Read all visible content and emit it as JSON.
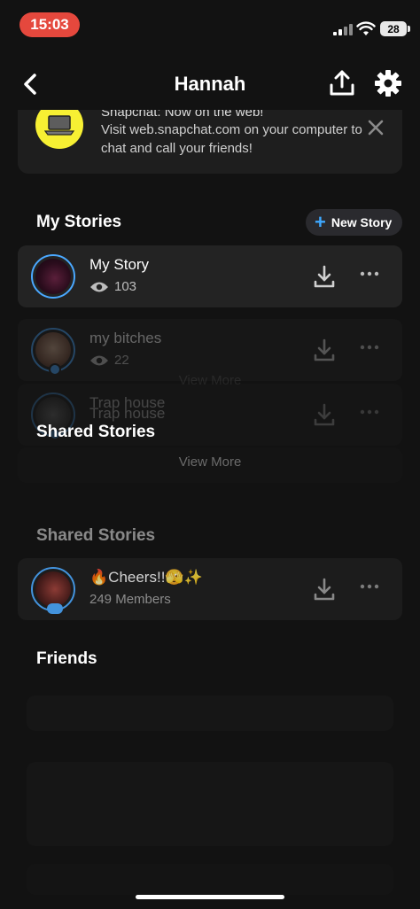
{
  "status": {
    "time": "15:03",
    "battery": "28"
  },
  "header": {
    "title": "Hannah"
  },
  "banner": {
    "title": "Snapchat: Now on the web!",
    "body": "Visit web.snapchat.com on your computer to chat and call your friends!"
  },
  "my_stories": {
    "title": "My Stories",
    "new_story_label": "New Story",
    "items": [
      {
        "name": "My Story",
        "views": "103"
      },
      {
        "name": "my bitches",
        "views": "22"
      },
      {
        "name": "Trap house"
      }
    ],
    "view_more_1": "View More",
    "view_more_2": "View More",
    "ghost_title_1": "Trap house",
    "ghost_section": "Shared Stories"
  },
  "shared_stories": {
    "title": "Shared Stories",
    "items": [
      {
        "name": "🔥Cheers!!🫣✨",
        "members": "249 Members"
      }
    ]
  },
  "friends": {
    "title": "Friends"
  },
  "colors": {
    "accent": "#4aa8ff",
    "time_pill": "#e5483d",
    "banner_icon": "#f7f033",
    "background": "#121212"
  }
}
